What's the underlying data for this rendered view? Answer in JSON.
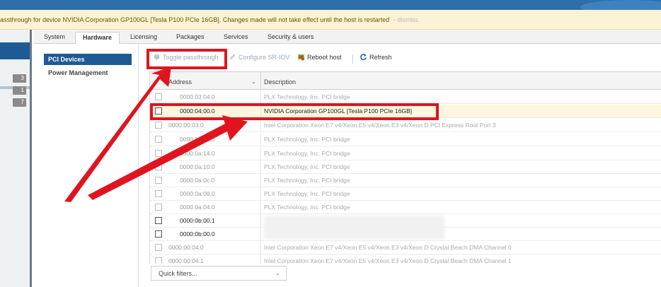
{
  "banner": {
    "message": "assthrough for device NVIDIA Corporation GP100GL [Tesla P100 PCIe 16GB]. Changes made will not take effect until the host is restarted",
    "dismiss": "- dismiss"
  },
  "leftnav": {
    "badges": [
      "3",
      "1",
      "7"
    ]
  },
  "tabs": [
    "System",
    "Hardware",
    "Licensing",
    "Packages",
    "Services",
    "Security & users"
  ],
  "subnav": {
    "items": [
      "PCI Devices",
      "Power Management"
    ]
  },
  "toolbar": {
    "toggle_passthrough": "Toggle passthrough",
    "configure_sriov": "Configure SR-IOV",
    "reboot_host": "Reboot host",
    "refresh": "Refresh"
  },
  "grid": {
    "col_address": "Address",
    "col_description": "Description",
    "rows": [
      {
        "address": "0000:03:04.0",
        "description": "PLX Technology, Inc. PCI bridge"
      },
      {
        "address": "0000:04:00.0",
        "description": "NVIDIA Corporation GP100GL [Tesla P100 PCIe 16GB]"
      },
      {
        "address": "0000:00:03.0",
        "description": "Intel Corporation Xeon E7 v4/Xeon E5 v4/Xeon E3 v4/Xeon D PCI Express Root Port 3"
      },
      {
        "address": "0000:09:00.0",
        "description": "PLX Technology, Inc. PCI bridge"
      },
      {
        "address": "0000:0a:14.0",
        "description": "PLX Technology, Inc. PCI bridge"
      },
      {
        "address": "0000:0a:10.0",
        "description": "PLX Technology, Inc. PCI bridge"
      },
      {
        "address": "0000:0a:0c.0",
        "description": "PLX Technology, Inc. PCI bridge"
      },
      {
        "address": "0000:0a:08.0",
        "description": "PLX Technology, Inc. PCI bridge"
      },
      {
        "address": "0000:0a:04.0",
        "description": "PLX Technology, Inc. PCI bridge"
      },
      {
        "address": "0000:0b:00.1",
        "description": ""
      },
      {
        "address": "0000:0b:00.0",
        "description": ""
      },
      {
        "address": "0000:00:04.0",
        "description": "Intel Corporation Xeon E7 v4/Xeon E5 v4/Xeon E3 v4/Xeon D Crystal Beach DMA Channel 0"
      },
      {
        "address": "0000:00:04.1",
        "description": "Intel Corporation Xeon E7 v4/Xeon E5 v4/Xeon E3 v4/Xeon D Crystal Beach DMA Channel 1"
      }
    ]
  },
  "filter": {
    "placeholder": "Quick filters..."
  },
  "colors": {
    "annotation": "#e0141f",
    "selected": "#1e5a93",
    "highlight_row": "#fdf7df"
  }
}
